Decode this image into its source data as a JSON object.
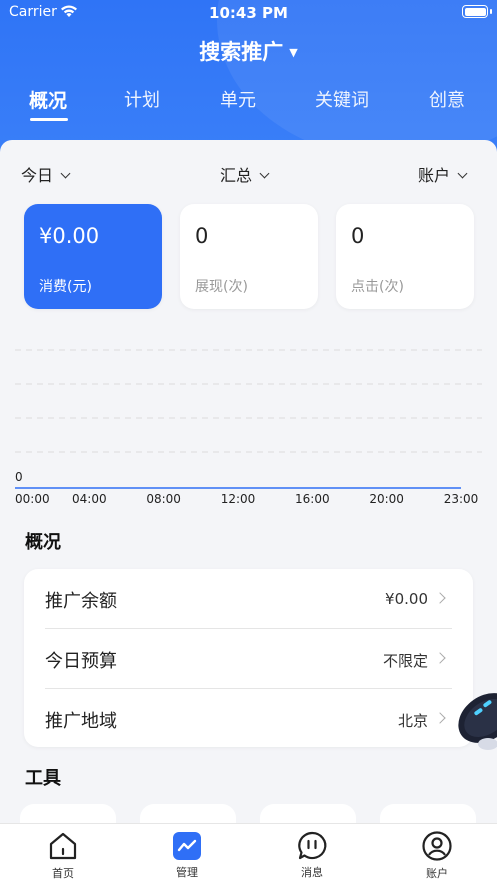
{
  "status": {
    "carrier": "Carrier",
    "time": "10:43 PM"
  },
  "header": {
    "title": "搜索推广"
  },
  "tabs": [
    "概况",
    "计划",
    "单元",
    "关键词",
    "创意"
  ],
  "filters": {
    "date": "今日",
    "mode": "汇总",
    "scope": "账户"
  },
  "metrics": [
    {
      "value": "¥0.00",
      "label": "消费(元)"
    },
    {
      "value": "0",
      "label": "展现(次)"
    },
    {
      "value": "0",
      "label": "点击(次)"
    }
  ],
  "chart_data": {
    "type": "line",
    "x": [
      "00:00",
      "04:00",
      "08:00",
      "12:00",
      "16:00",
      "20:00",
      "23:00"
    ],
    "y_tick": "0",
    "series": [
      {
        "values": [
          0,
          0,
          0,
          0,
          0,
          0,
          0
        ]
      }
    ],
    "grid": true,
    "color": "#2f6ff6"
  },
  "overview": {
    "title": "概况",
    "rows": [
      {
        "label": "推广余额",
        "value": "¥0.00"
      },
      {
        "label": "今日预算",
        "value": "不限定"
      },
      {
        "label": "推广地域",
        "value": "北京"
      }
    ]
  },
  "tools": {
    "title": "工具"
  },
  "nav": [
    "首页",
    "管理",
    "消息",
    "账户"
  ],
  "colors": {
    "brand": "#2f6ff6"
  }
}
